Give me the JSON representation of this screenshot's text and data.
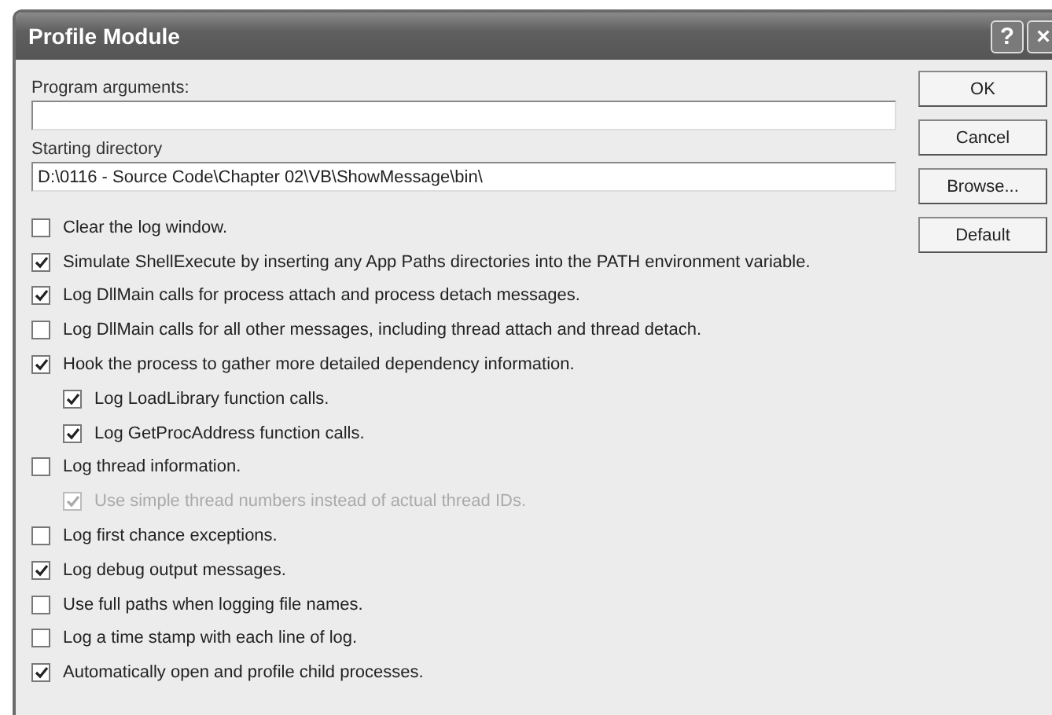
{
  "window": {
    "title": "Profile Module",
    "title_buttons": [
      "?",
      "×"
    ]
  },
  "fields": [
    {
      "label": "Program arguments:"
    },
    {
      "label": "Starting directory",
      "value": "D:\\0116 - Source Code\\Chapter 02\\VB\\ShowMessage\\bin\\"
    }
  ],
  "buttons": [
    "OK",
    "Cancel",
    "Browse...",
    "Default"
  ],
  "options": [
    {
      "label": "Clear the log window.",
      "checked": false,
      "disabled": false
    },
    {
      "label": "Simulate ShellExecute by inserting any App Paths directories into the PATH environment variable.",
      "checked": true,
      "disabled": false
    },
    {
      "label": "Log DllMain calls for process attach and process detach messages.",
      "checked": true,
      "disabled": false
    },
    {
      "label": "Log DllMain calls for all other messages, including thread attach and thread detach.",
      "checked": false,
      "disabled": false
    },
    {
      "label": "Hook the process to gather more detailed dependency information.",
      "checked": true,
      "disabled": false,
      "children": [
        {
          "label": "Log LoadLibrary function calls.",
          "checked": true,
          "disabled": false
        },
        {
          "label": "Log GetProcAddress function calls.",
          "checked": true,
          "disabled": false
        }
      ]
    },
    {
      "label": "Log thread information.",
      "checked": false,
      "disabled": false,
      "children": [
        {
          "label": "Use simple thread numbers instead of actual thread IDs.",
          "checked": true,
          "disabled": true
        }
      ]
    },
    {
      "label": "Log first chance exceptions.",
      "checked": false,
      "disabled": false
    },
    {
      "label": "Log debug output messages.",
      "checked": true,
      "disabled": false
    },
    {
      "label": "Use full paths when logging file names.",
      "checked": false,
      "disabled": false
    },
    {
      "label": "Log a time stamp with each line of log.",
      "checked": false,
      "disabled": false
    },
    {
      "label": "Automatically open and profile child processes.",
      "checked": true,
      "disabled": false
    }
  ]
}
